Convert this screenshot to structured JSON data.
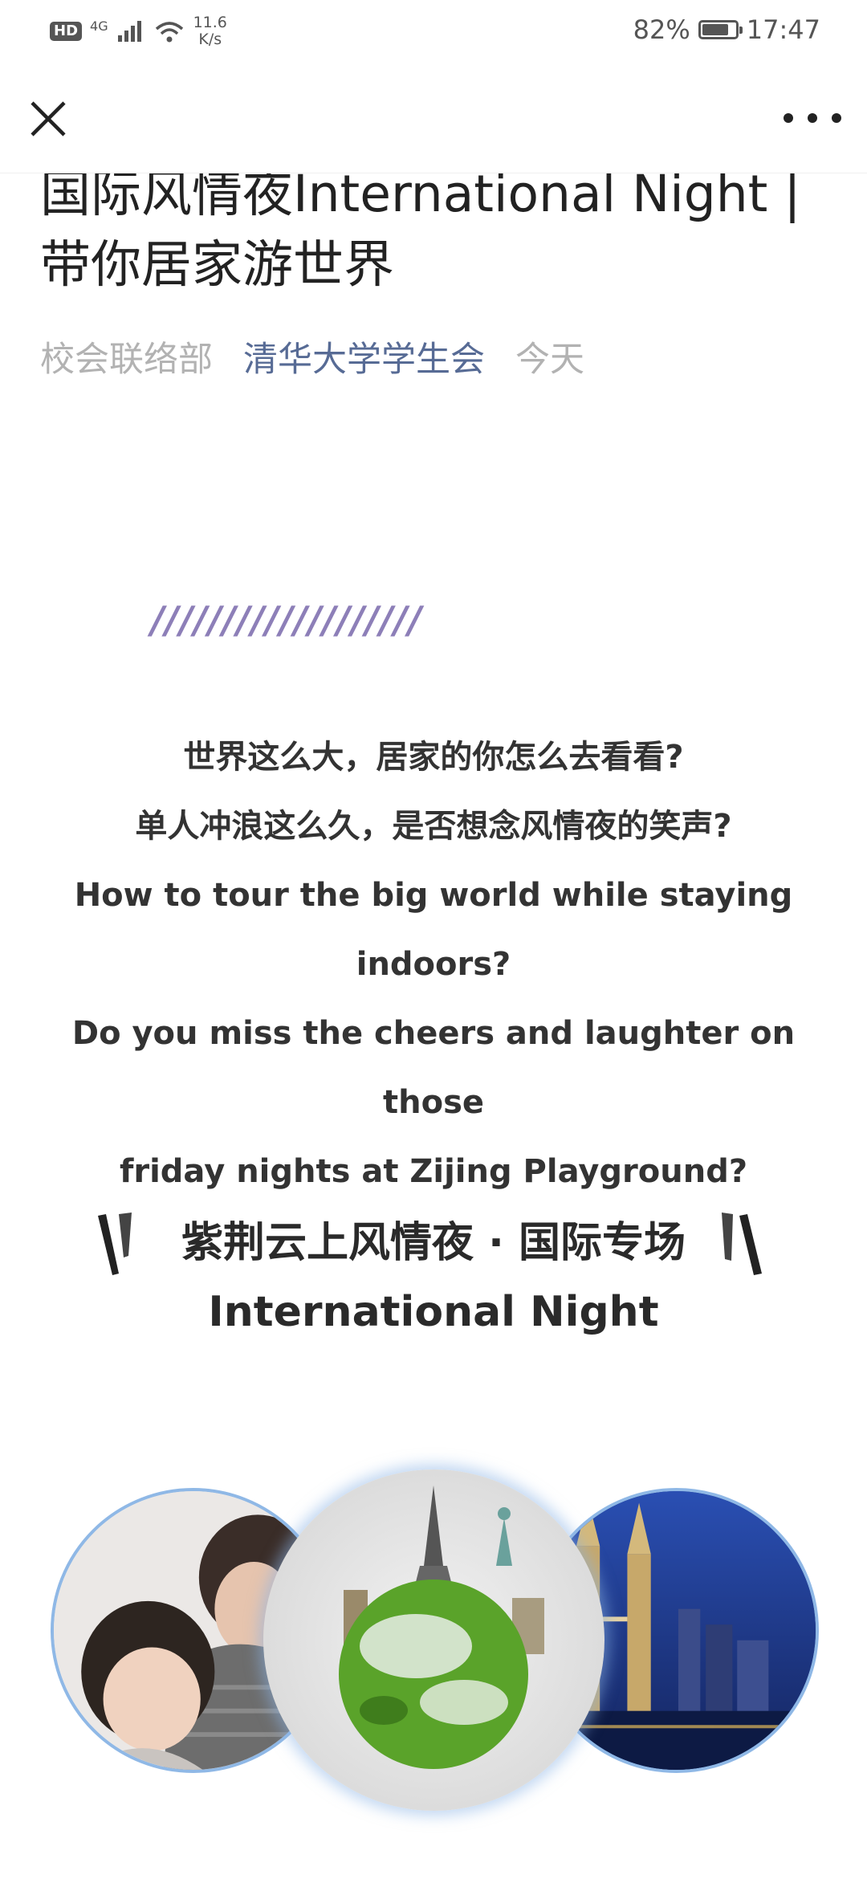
{
  "status_bar": {
    "hd": "HD",
    "network": "4G",
    "speed_value": "11.6",
    "speed_unit": "K/s",
    "battery_percent": "82%",
    "battery_level": 0.82,
    "time": "17:47"
  },
  "nav": {
    "close_icon": "close-icon",
    "more_icon": "more-icon"
  },
  "article": {
    "title": "国际风情夜International Night | 带你居家游世界",
    "author": "校会联络部",
    "account": "清华大学学生会",
    "date": "今天"
  },
  "divider_text": "///////////////////",
  "intro": {
    "line1": "世界这么大，居家的你怎么去看看?",
    "line2": "单人冲浪这么久，是否想念风情夜的笑声?",
    "line3": "How to tour the big world while staying",
    "line4": "indoors?",
    "line5": "Do you miss the cheers and laughter on those",
    "line6": "friday nights at Zijing Playground?"
  },
  "section": {
    "title_cn": "紫荆云上风情夜 · 国际专场",
    "title_en": "International Night"
  },
  "images": [
    {
      "name": "couple-photo"
    },
    {
      "name": "globe-landmarks-photo"
    },
    {
      "name": "city-towers-photo"
    }
  ],
  "colors": {
    "account_link": "#576b95",
    "meta_gray": "#b2b2b2",
    "slash_purple": "#8d7fb8",
    "circle_border": "#8fb8e6"
  }
}
